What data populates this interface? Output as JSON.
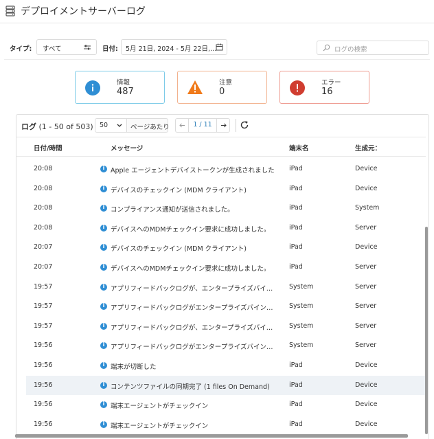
{
  "header": {
    "title": "デプロイメントサーバーログ",
    "icon": "server-icon"
  },
  "filters": {
    "type_label": "タイプ:",
    "type_value": "すべて",
    "date_label": "日付:",
    "date_value": "5月 21日, 2024 - 5月 22日,…",
    "search_placeholder": "ログの検索"
  },
  "summary": {
    "info": {
      "label": "情報",
      "count": "487",
      "color": "#2f8ed4"
    },
    "warning": {
      "label": "注意",
      "count": "0",
      "color": "#f07a1a"
    },
    "error": {
      "label": "エラー",
      "count": "16",
      "color": "#d03d30"
    }
  },
  "log": {
    "title": "ログ",
    "range": "(1 - 50 of 503)",
    "per_page_value": "50",
    "per_page_label": "ページあたり",
    "page_indicator": "1 / 11",
    "columns": {
      "time": "日付/時間",
      "message": "メッセージ",
      "device": "端末名",
      "source": "生成元："
    },
    "rows": [
      {
        "time": "20:08",
        "message": "Apple エージェントデバイストークンが生成されました",
        "device": "iPad",
        "source": "Device"
      },
      {
        "time": "20:08",
        "message": "デバイスのチェックイン (MDM クライアント)",
        "device": "iPad",
        "source": "Device"
      },
      {
        "time": "20:08",
        "message": "コンプライアンス通知が送信されました。",
        "device": "iPad",
        "source": "System"
      },
      {
        "time": "20:08",
        "message": "デバイスへのMDMチェックイン要求に成功しました。",
        "device": "iPad",
        "source": "Server"
      },
      {
        "time": "20:07",
        "message": "デバイスのチェックイン (MDM クライアント)",
        "device": "iPad",
        "source": "Device"
      },
      {
        "time": "20:07",
        "message": "デバイスへのMDMチェックイン要求に成功しました。",
        "device": "iPad",
        "source": "Server"
      },
      {
        "time": "19:57",
        "message": "アプリフィードバックログが、エンタープライズバイン…",
        "device": "System",
        "source": "Server"
      },
      {
        "time": "19:57",
        "message": "アプリフィードバックログがエンタープライズバインデ…",
        "device": "System",
        "source": "Server"
      },
      {
        "time": "19:57",
        "message": "アプリフィードバックログが、エンタープライズバイン…",
        "device": "System",
        "source": "Server"
      },
      {
        "time": "19:56",
        "message": "アプリフィードバックログがエンタープライズバインデ…",
        "device": "System",
        "source": "Server"
      },
      {
        "time": "19:56",
        "message": "端末が切断した",
        "device": "iPad",
        "source": "Device"
      },
      {
        "time": "19:56",
        "message": "コンテンツファイルの同期完了 (1 files On Demand)",
        "device": "iPad",
        "source": "Device"
      },
      {
        "time": "19:56",
        "message": "端末エージェントがチェックイン",
        "device": "iPad",
        "source": "Device"
      },
      {
        "time": "19:56",
        "message": "端末エージェントがチェックイン",
        "device": "iPad",
        "source": "Device"
      }
    ],
    "highlighted_row": 11
  }
}
